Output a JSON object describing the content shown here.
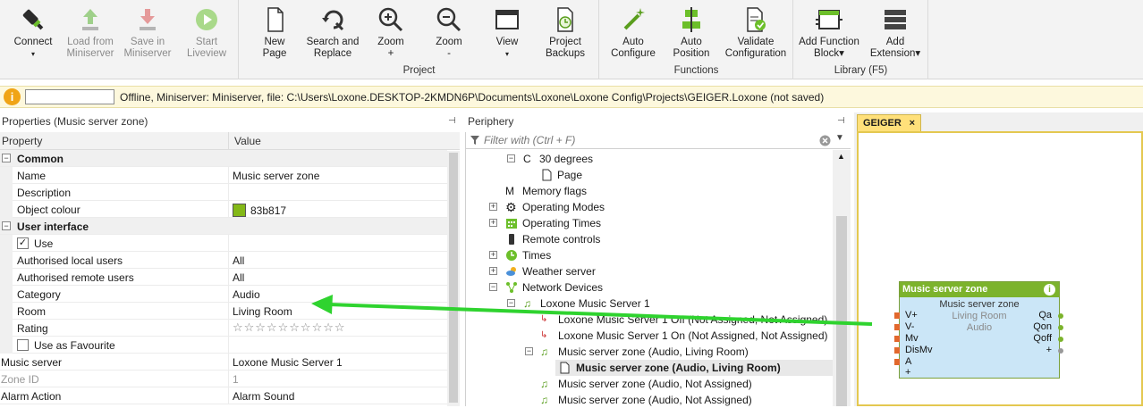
{
  "ribbon": {
    "buttons": {
      "connect": {
        "label": "Connect",
        "sub": "▾"
      },
      "load": {
        "label": "Load from",
        "sub": "Miniserver"
      },
      "save": {
        "label": "Save in",
        "sub": "Miniserver"
      },
      "liveview": {
        "label": "Start",
        "sub": "Liveview"
      },
      "new_page": {
        "label": "New",
        "sub": "Page"
      },
      "search": {
        "label": "Search and",
        "sub": "Replace"
      },
      "zoom_in": {
        "label": "Zoom",
        "sub": "+"
      },
      "zoom_out": {
        "label": "Zoom",
        "sub": "-"
      },
      "view": {
        "label": "View",
        "sub": "▾"
      },
      "backups": {
        "label": "Project",
        "sub": "Backups"
      },
      "auto_config": {
        "label": "Auto",
        "sub": "Configure"
      },
      "auto_pos": {
        "label": "Auto",
        "sub": "Position"
      },
      "validate": {
        "label": "Validate",
        "sub": "Configuration"
      },
      "add_fb": {
        "label": "Add Function",
        "sub": "Block▾"
      },
      "add_ext": {
        "label": "Add",
        "sub": "Extension▾"
      }
    },
    "groups": {
      "project": "Project",
      "functions": "Functions",
      "library": "Library (F5)"
    }
  },
  "status": {
    "icon": "i",
    "text": "Offline, Miniserver: Miniserver, file: C:\\Users\\Loxone.DESKTOP-2KMDN6P\\Documents\\Loxone\\Loxone Config\\Projects\\GEIGER.Loxone (not saved)"
  },
  "properties": {
    "title": "Properties (Music server zone)",
    "col_property": "Property",
    "col_value": "Value",
    "cat_common": "Common",
    "cat_ui": "User interface",
    "rows": {
      "name": {
        "k": "Name",
        "v": "Music server zone"
      },
      "description": {
        "k": "Description",
        "v": ""
      },
      "colour": {
        "k": "Object colour",
        "v": "83b817"
      },
      "use": {
        "k": "Use",
        "v": ""
      },
      "auth_local": {
        "k": "Authorised local users",
        "v": "All"
      },
      "auth_remote": {
        "k": "Authorised remote users",
        "v": "All"
      },
      "category": {
        "k": "Category",
        "v": "Audio"
      },
      "room": {
        "k": "Room",
        "v": "Living Room"
      },
      "rating": {
        "k": "Rating",
        "v": "☆☆☆☆☆☆☆☆☆☆"
      },
      "favourite": {
        "k": "Use as Favourite",
        "v": ""
      },
      "music_server": {
        "k": "Music server",
        "v": "Loxone Music Server 1"
      },
      "zone_id": {
        "k": "Zone ID",
        "v": "1"
      },
      "alarm": {
        "k": "Alarm Action",
        "v": "Alarm Sound"
      }
    }
  },
  "periphery": {
    "title": "Periphery",
    "filter_placeholder": "Filter with (Ctrl + F)",
    "items": {
      "deg30": "30 degrees",
      "page": "Page",
      "memflags": "Memory flags",
      "opmodes": "Operating Modes",
      "optimes": "Operating Times",
      "remote": "Remote controls",
      "times": "Times",
      "weather": "Weather server",
      "network": "Network Devices",
      "lms1": "Loxone Music Server 1",
      "lms_off": "Loxone Music Server 1 Off (Not Assigned, Not Assigned)",
      "lms_on": "Loxone Music Server 1 On (Not Assigned, Not Assigned)",
      "zone_lr": "Music server zone (Audio, Living Room)",
      "zone_lr_sel": "Music server zone (Audio, Living Room)",
      "zone_na1": "Music server zone (Audio, Not Assigned)",
      "zone_na2": "Music server zone (Audio, Not Assigned)"
    }
  },
  "canvas": {
    "tab": "GEIGER",
    "tab_close": "×",
    "block": {
      "header": "Music server zone",
      "title": "Music server zone",
      "room": "Living Room",
      "category": "Audio",
      "inputs": [
        "V+",
        "V-",
        "Mv",
        "DisMv",
        "A",
        "+"
      ],
      "outputs": [
        "Qa",
        "Qon",
        "Qoff",
        "+"
      ],
      "info": "i"
    }
  },
  "colors": {
    "accent": "#83b817",
    "arrow": "#2fd32f"
  }
}
